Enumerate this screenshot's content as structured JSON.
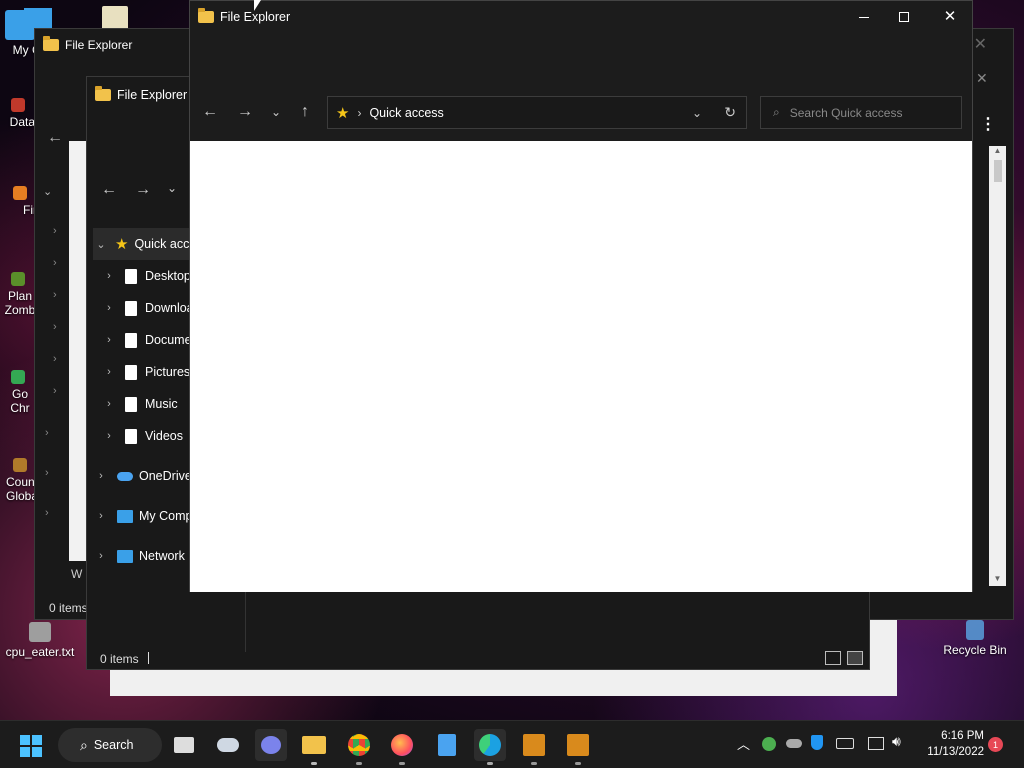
{
  "desktop": {
    "icons": [
      {
        "label": "My Co",
        "color": "#3aa0e8"
      },
      {
        "label": "DataW",
        "color": "#c0392b"
      },
      {
        "label": "Fir",
        "color": "#e67e22"
      },
      {
        "label": "Plan Zomb",
        "color": "#5a8f2a"
      },
      {
        "label": "Go Chr",
        "color": "#34a853"
      },
      {
        "label": "Count Globa",
        "color": "#b07a2a"
      },
      {
        "label": "cpu_eater.txt",
        "color": "#9e9e9e"
      },
      {
        "label": "Recycle Bin",
        "color": "#5aa9e6"
      }
    ]
  },
  "windows": {
    "back_title": "File Explorer",
    "back_status": "0 items",
    "back_partial_text": "W",
    "middle_title": "File Explorer",
    "middle_status": "0 items",
    "middle_tree": [
      {
        "label": "Quick acc",
        "icon": "star-icon",
        "expanded": true
      },
      {
        "label": "Desktop",
        "icon": "file-icon"
      },
      {
        "label": "Downloa",
        "icon": "file-icon"
      },
      {
        "label": "Docume",
        "icon": "file-icon"
      },
      {
        "label": "Pictures",
        "icon": "file-icon"
      },
      {
        "label": "Music",
        "icon": "file-icon"
      },
      {
        "label": "Videos",
        "icon": "file-icon"
      },
      {
        "label": "OneDrive",
        "icon": "cloud-icon"
      },
      {
        "label": "My Comp",
        "icon": "computer-icon"
      },
      {
        "label": "Network",
        "icon": "network-icon"
      }
    ],
    "front_title": "File Explorer",
    "front_address": "Quick access",
    "front_search_placeholder": "Search Quick access"
  },
  "taskbar": {
    "search_label": "Search",
    "time": "6:16 PM",
    "date": "11/13/2022",
    "notification_count": "1"
  },
  "colors": {
    "accent": "#0078d4",
    "folder": "#f2c24b",
    "star": "#f5c518"
  }
}
